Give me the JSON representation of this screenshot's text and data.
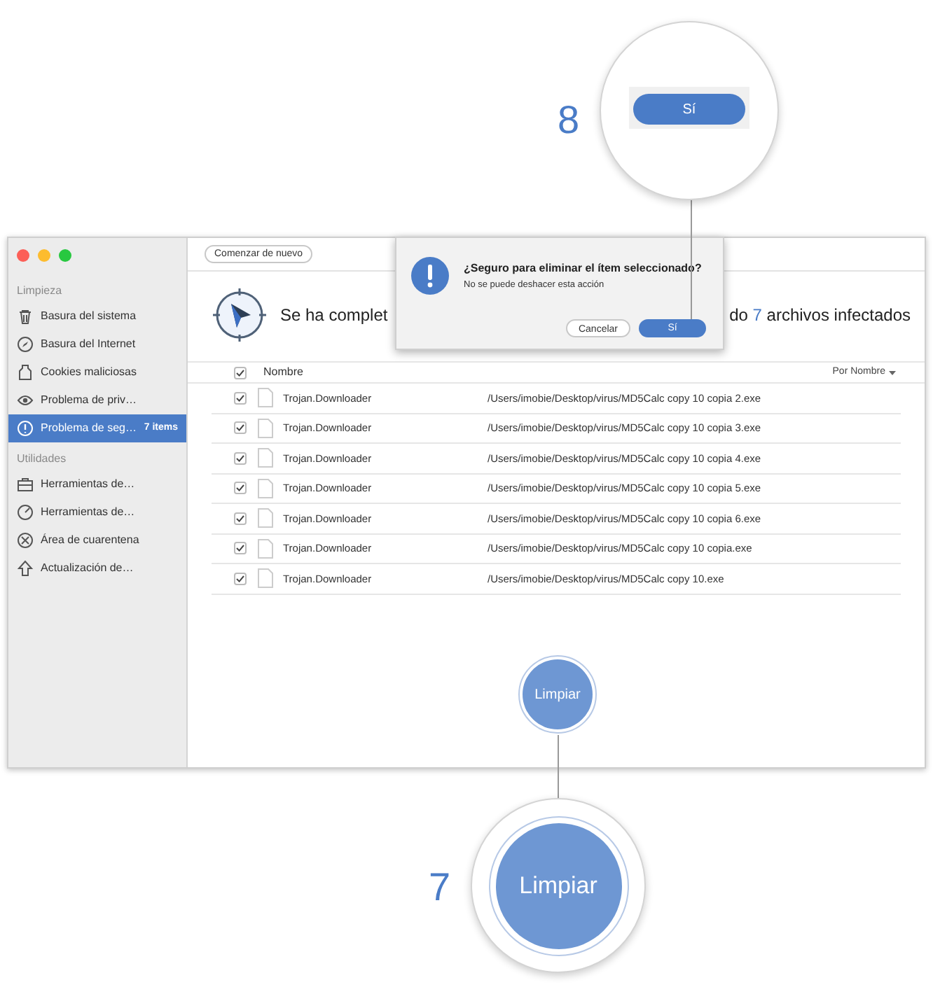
{
  "window": {
    "toolbar_button": "Comenzar de nuevo"
  },
  "sidebar": {
    "sections": [
      {
        "title": "Limpieza",
        "items": [
          {
            "label": "Basura del sistema",
            "selected": false
          },
          {
            "label": "Basura del Internet",
            "selected": false
          },
          {
            "label": "Cookies maliciosas",
            "selected": false
          },
          {
            "label": "Problema de priv…",
            "selected": false
          },
          {
            "label": "Problema de seg…",
            "badge": "7 items",
            "selected": true
          }
        ]
      },
      {
        "title": "Utilidades",
        "items": [
          {
            "label": "Herramientas de…",
            "selected": false
          },
          {
            "label": "Herramientas de…",
            "selected": false
          },
          {
            "label": "Área de cuarentena",
            "selected": false
          },
          {
            "label": "Actualización de…",
            "selected": false
          }
        ]
      }
    ]
  },
  "heading": {
    "start": "Se ha complet",
    "end_before": "do",
    "count": "7",
    "end_after": "archivos infectados"
  },
  "table": {
    "header": {
      "checked": true,
      "name": "Nombre",
      "sort": "Por Nombre"
    },
    "rows": [
      {
        "checked": true,
        "name": "Trojan.Downloader",
        "path": "/Users/imobie/Desktop/virus/MD5Calc copy 10 copia 2.exe"
      },
      {
        "checked": true,
        "name": "Trojan.Downloader",
        "path": "/Users/imobie/Desktop/virus/MD5Calc copy 10 copia 3.exe"
      },
      {
        "checked": true,
        "name": "Trojan.Downloader",
        "path": "/Users/imobie/Desktop/virus/MD5Calc copy 10 copia 4.exe"
      },
      {
        "checked": true,
        "name": "Trojan.Downloader",
        "path": "/Users/imobie/Desktop/virus/MD5Calc copy 10 copia 5.exe"
      },
      {
        "checked": true,
        "name": "Trojan.Downloader",
        "path": "/Users/imobie/Desktop/virus/MD5Calc copy 10 copia 6.exe"
      },
      {
        "checked": true,
        "name": "Trojan.Downloader",
        "path": "/Users/imobie/Desktop/virus/MD5Calc copy 10 copia.exe"
      },
      {
        "checked": true,
        "name": "Trojan.Downloader",
        "path": "/Users/imobie/Desktop/virus/MD5Calc copy 10.exe"
      }
    ]
  },
  "clean_button": "Limpiar",
  "dialog": {
    "title": "¿Seguro para eliminar el ítem seleccionado?",
    "message": "No se puede deshacer esta acción",
    "buttons": [
      {
        "label": "Cancelar",
        "primary": false
      },
      {
        "label": "Sí",
        "primary": true
      }
    ]
  },
  "callouts": [
    {
      "number": "8",
      "button": "Sí"
    },
    {
      "number": "7",
      "button": "Limpiar"
    }
  ]
}
